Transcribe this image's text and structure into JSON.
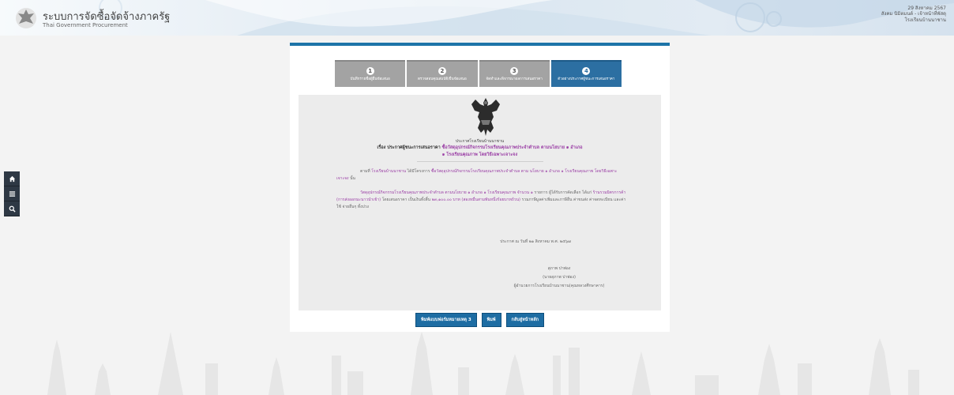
{
  "header": {
    "title_th": "ระบบการจัดซื้อจัดจ้างภาครัฐ",
    "title_en": "Thai Government Procurement",
    "date": "29 สิงหาคม 2567",
    "user_line1": "สังคม นิมิตมนต์ - เจ้าหน้าที่พัสดุ",
    "user_line2": "โรงเรียนบ้านนาชาน"
  },
  "sidebar": {
    "home_icon": "home-icon",
    "menu_icon": "menu-icon",
    "search_icon": "search-icon"
  },
  "steps": [
    {
      "num": "1",
      "label": "บันทึกรายชื่อผู้ยื่นข้อเสนอ",
      "active": false
    },
    {
      "num": "2",
      "label": "ตรวจสอบคุณสมบัติ/ยื่นข้อเสนอ",
      "active": false
    },
    {
      "num": "3",
      "label": "จัดทำและพิจารณาผลการเสนอราคา",
      "active": false
    },
    {
      "num": "4",
      "label": "ตัวอย่างประกาศผู้ชนะการเสนอราคา",
      "active": true
    }
  ],
  "document": {
    "org": "ประกาศโรงเรียนบ้านนาชาน",
    "subject_prefix": "เรื่อง ประกาศผู้ชนะการเสนอราคา",
    "subject_item": "ซื้อวัสดุอุปกรณ์กิจกรรมโรงเรียนคุณภาพประจำตำบล ตามนโยบาย ๑ อำเภอ",
    "subject_line2": "๑ โรงเรียนคุณภาพ โดยวิธีเฉพาะเจาะจง",
    "para1_a": "ตามที่",
    "para1_b": "โรงเรียนบ้านนาชาน",
    "para1_c": "ได้มีโครงการ",
    "para1_d": "ซื้อวัสดุอุปกรณ์กิจกรรมโรงเรียนคุณภาพประจำตำบล ตาม",
    "para1_e": "นโยบาย ๑ อำเภอ ๑ โรงเรียนคุณภาพ โดยวิธีเฉพาะเจาะจง",
    "para1_f": "นั้น",
    "para2_a": "วัสดุอุปกรณ์กิจกรรมโรงเรียนคุณภาพประจำตำบล ตามนโยบาย ๑ อำเภอ ๑ โรงเรียนคุณภาพ จำนวน ๑",
    "para2_b": "รายการ ผู้ได้รับการคัดเลือก ได้แก่",
    "para2_c": "ร้านรวมมิตรการค้า (การส่งออกมะนาวนำเข้า)",
    "para2_d": "โดยเสนอราคา เป็นเงินทั้งสิ้น",
    "para2_e": "๒๓,๑๐๐.๐๐ บาท (สองหมื่นสามพันหนึ่งร้อยบาทถ้วน)",
    "para2_f": "รวมภาษีมูลค่าเพิ่มและภาษีอื่น ค่าขนส่ง ค่าจดทะเบียน และค่าใช้",
    "para2_g": "จ่ายอื่นๆ ทั้งปวง",
    "announce_date": "ประกาศ ณ วันที่  ๒๑ สิงหาคม พ.ศ. ๒๕๖๗",
    "sig_name": "(นายสุภาพ ปาพ่อง)",
    "sig_name_plain": "สุภาพ ปาพ่อง",
    "sig_position": "ผู้อำนวยการโรงเรียนบ้านนาชาน(คุณหลวงศึกษาคาร)"
  },
  "buttons": {
    "print_form": "พิมพ์แบบฟอร์มหมายเหตุ 3",
    "print": "พิมพ์",
    "back": "กลับสู่หน้าหลัก"
  }
}
